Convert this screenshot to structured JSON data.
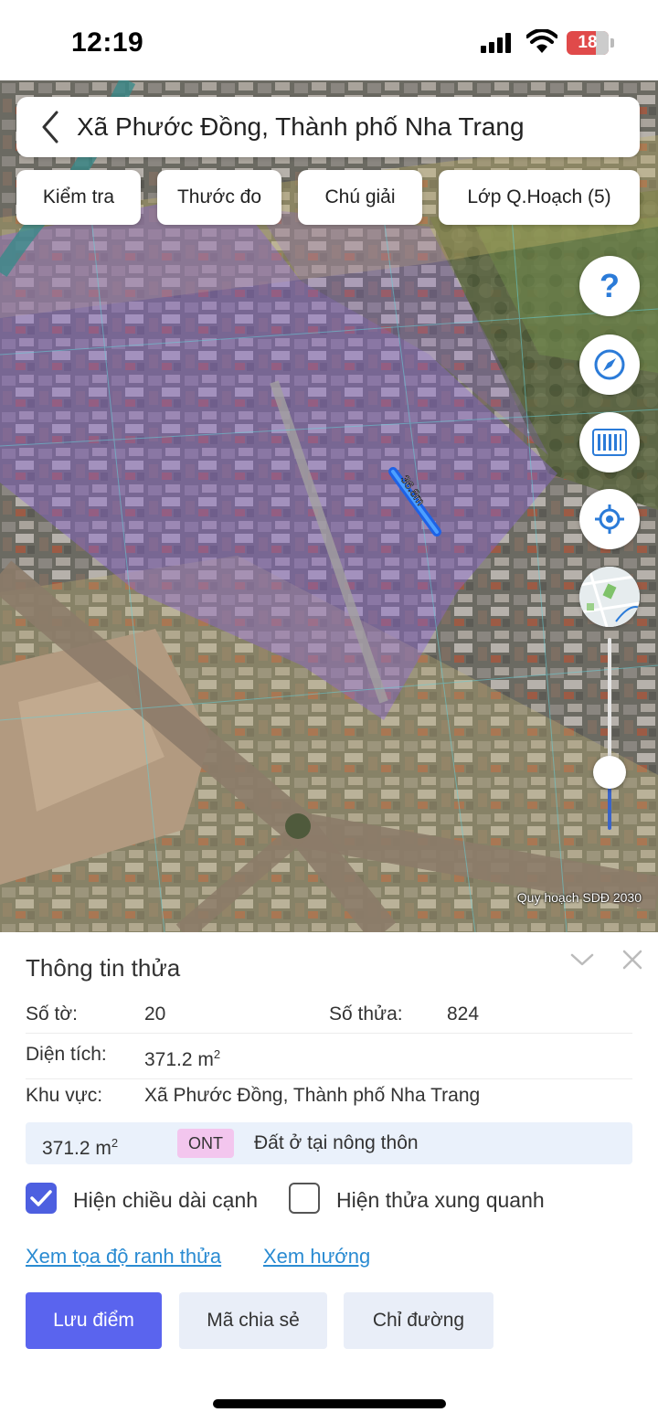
{
  "status_bar": {
    "time": "12:19",
    "battery": "18"
  },
  "search": {
    "title": "Xã Phước Đồng, Thành phố Nha Trang"
  },
  "toolbar": [
    {
      "label": "Kiểm tra"
    },
    {
      "label": "Thước đo"
    },
    {
      "label": "Chú giải"
    },
    {
      "label": "Lớp Q.Hoạch (5)"
    }
  ],
  "map": {
    "measure_label": "36.8m",
    "caption": "Quy hoạch SDĐ 2030",
    "zoom_level_fraction": 0.3
  },
  "map_controls": {
    "help": "?",
    "icons": [
      "help-icon",
      "compass-icon",
      "barcode-icon",
      "locate-icon",
      "minimap-icon"
    ]
  },
  "parcel": {
    "title": "Thông tin thửa",
    "sheet_label": "Số tờ:",
    "sheet_value": "20",
    "parcel_label": "Số thửa:",
    "parcel_value": "824",
    "area_label": "Diện tích:",
    "area_value": "371.2 m",
    "area_unit_sup": "2",
    "region_label": "Khu vực:",
    "region_value": "Xã Phước Đồng, Thành phố Nha Trang",
    "zone": {
      "area": "371.2 m",
      "area_sup": "2",
      "code": "ONT",
      "name": "Đất ở tại nông thôn"
    }
  },
  "options": {
    "show_edges": {
      "label": "Hiện chiều dài cạnh",
      "checked": true
    },
    "show_neighbors": {
      "label": "Hiện thửa xung quanh",
      "checked": false
    }
  },
  "links": {
    "coords": "Xem tọa độ ranh thửa",
    "direction": "Xem hướng"
  },
  "actions": {
    "save": "Lưu điểm",
    "share": "Mã chia sẻ",
    "route": "Chỉ đường"
  },
  "colors": {
    "accent": "#5a64ee",
    "link": "#2a8bd2",
    "zone_badge": "#f3c6ee",
    "zone_row": "#eaf1fb"
  }
}
